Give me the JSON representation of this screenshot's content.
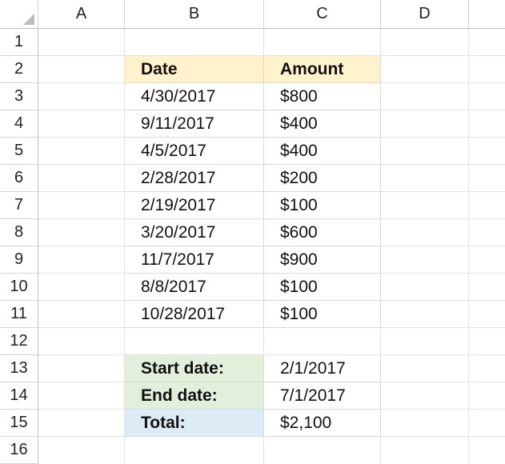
{
  "spreadsheet": {
    "columns": [
      "A",
      "B",
      "C",
      "D"
    ],
    "rows": [
      "1",
      "2",
      "3",
      "4",
      "5",
      "6",
      "7",
      "8",
      "9",
      "10",
      "11",
      "12",
      "13",
      "14",
      "15",
      "16"
    ],
    "table": {
      "header": {
        "date": "Date",
        "amount": "Amount"
      },
      "rows": [
        {
          "date": "4/30/2017",
          "amount": "$800"
        },
        {
          "date": "9/11/2017",
          "amount": "$400"
        },
        {
          "date": "4/5/2017",
          "amount": "$400"
        },
        {
          "date": "2/28/2017",
          "amount": "$200"
        },
        {
          "date": "2/19/2017",
          "amount": "$100"
        },
        {
          "date": "3/20/2017",
          "amount": "$600"
        },
        {
          "date": "11/7/2017",
          "amount": "$900"
        },
        {
          "date": "8/8/2017",
          "amount": "$100"
        },
        {
          "date": "10/28/2017",
          "amount": "$100"
        }
      ]
    },
    "summary": {
      "start_label": "Start date:",
      "start_value": "2/1/2017",
      "end_label": "End date:",
      "end_value": "7/1/2017",
      "total_label": "Total:",
      "total_value": "$2,100"
    },
    "colors": {
      "header_fill": "#fff2cc",
      "criteria_fill": "#e2efda",
      "total_fill": "#ddebf7"
    }
  }
}
